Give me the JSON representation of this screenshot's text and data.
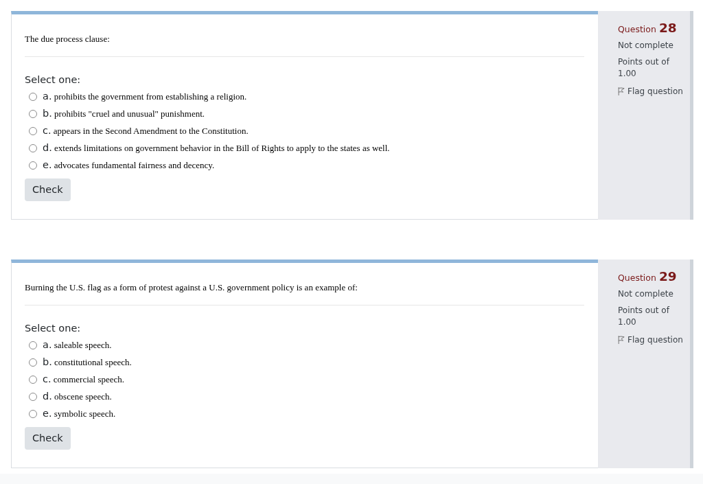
{
  "questions": [
    {
      "info": {
        "label": "Question",
        "number": "28",
        "status": "Not complete",
        "points": "Points out of 1.00",
        "flag": "Flag question"
      },
      "text": "The due process clause:",
      "prompt": "Select one:",
      "options": [
        {
          "letter": "a.",
          "text": "prohibits the government from establishing a religion.",
          "selected": false
        },
        {
          "letter": "b.",
          "text": "prohibits \"cruel and unusual\" punishment.",
          "selected": false
        },
        {
          "letter": "c.",
          "text": "appears in the Second Amendment to the Constitution.",
          "selected": false
        },
        {
          "letter": "d.",
          "text": "extends limitations on government behavior in the Bill of Rights to apply to the states as well.",
          "selected": false
        },
        {
          "letter": "e.",
          "text": "advocates fundamental fairness and decency.",
          "selected": false
        }
      ],
      "button": "Check"
    },
    {
      "info": {
        "label": "Question",
        "number": "29",
        "status": "Not complete",
        "points": "Points out of 1.00",
        "flag": "Flag question"
      },
      "text": "Burning the U.S. flag as a form of protest against a U.S. government policy is an example of:",
      "prompt": "Select one:",
      "options": [
        {
          "letter": "a.",
          "text": "saleable speech.",
          "selected": false
        },
        {
          "letter": "b.",
          "text": "constitutional speech.",
          "selected": false
        },
        {
          "letter": "c.",
          "text": "commercial speech.",
          "selected": false
        },
        {
          "letter": "d.",
          "text": "obscene speech.",
          "selected": false
        },
        {
          "letter": "e.",
          "text": "symbolic speech.",
          "selected": false
        }
      ],
      "button": "Check"
    }
  ]
}
